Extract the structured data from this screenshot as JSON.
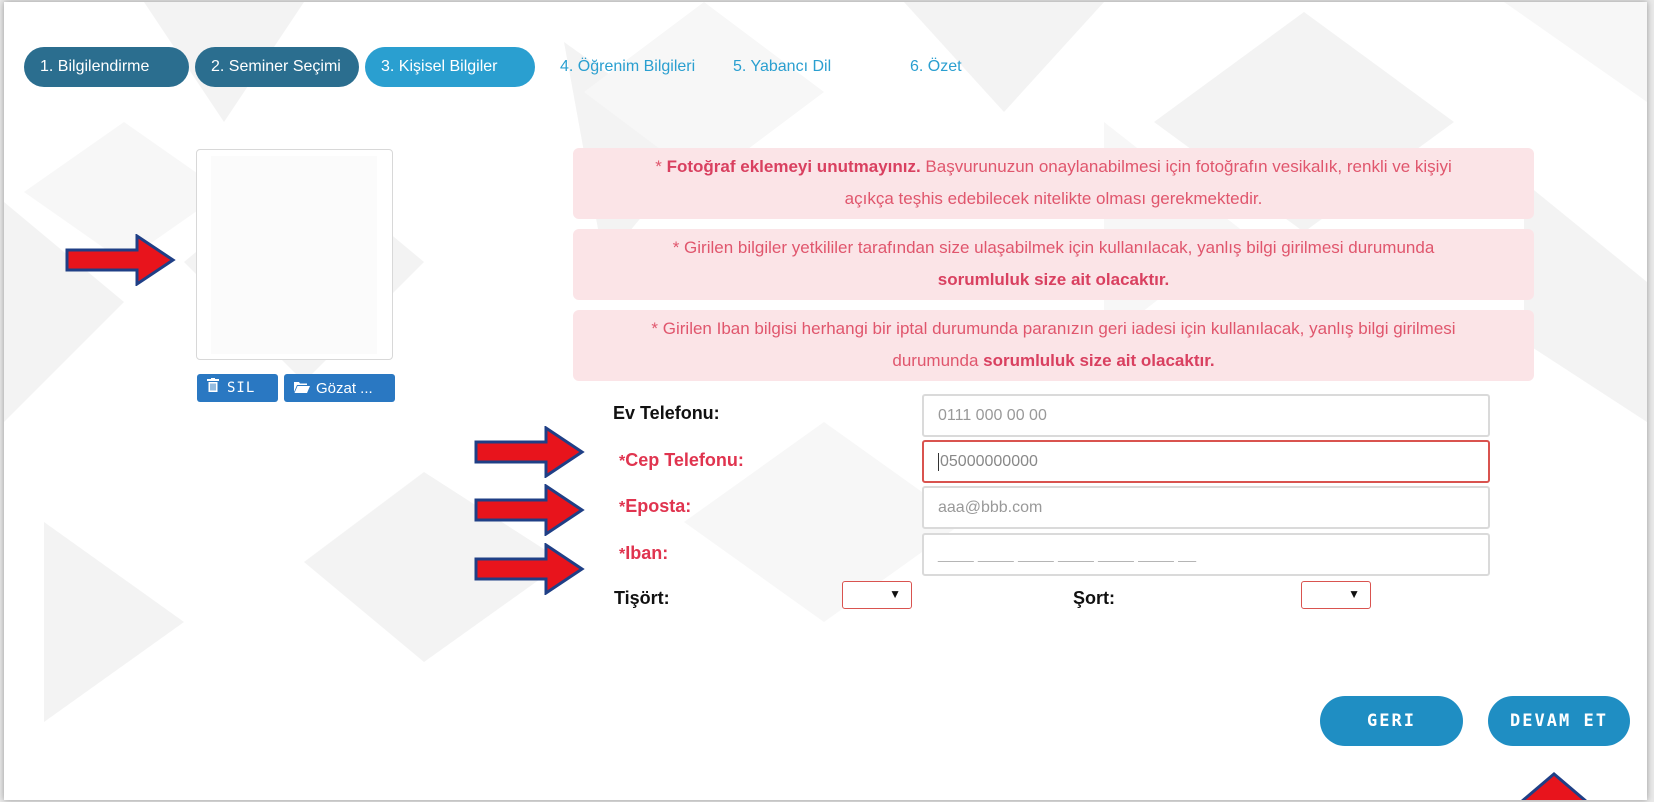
{
  "steps": [
    {
      "label": "1. Bilgilendirme",
      "state": "done"
    },
    {
      "label": "2. Seminer Seçimi",
      "state": "done"
    },
    {
      "label": "3. Kişisel Bilgiler",
      "state": "active"
    },
    {
      "label": "4. Öğrenim Bilgileri",
      "state": "pending"
    },
    {
      "label": "5. Yabancı Dil",
      "state": "pending"
    },
    {
      "label": "6. Özet",
      "state": "pending"
    }
  ],
  "photo": {
    "delete_label": "SIL",
    "browse_label": "Gözat ..."
  },
  "alerts": [
    {
      "pre": "* ",
      "bold": "Fotoğraf eklemeyi unutmayınız.",
      "rest": " Başvurunuzun onaylanabilmesi için fotoğrafın vesikalık, renkli ve kişiyi",
      "line2": "açıkça teşhis edebilecek nitelikte olması gerekmektedir."
    },
    {
      "line1": "* Girilen bilgiler yetkililer tarafından size ulaşabilmek için kullanılacak, yanlış bilgi girilmesi durumunda",
      "bold2": "sorumluluk size ait olacaktır."
    },
    {
      "line1": "* Girilen Iban bilgisi herhangi bir iptal durumunda paranızın geri iadesi için kullanılacak, yanlış bilgi girilmesi",
      "pre2": "durumunda ",
      "bold2": "sorumluluk size ait olacaktır."
    }
  ],
  "form": {
    "home_phone": {
      "label": "Ev Telefonu:",
      "placeholder": "0111 000 00 00"
    },
    "mobile_phone": {
      "star": "*",
      "label": "Cep Telefonu:",
      "placeholder": "05000000000"
    },
    "email": {
      "star": "*",
      "label": "Eposta:",
      "placeholder": "aaa@bbb.com"
    },
    "iban": {
      "star": "*",
      "label": "Iban:",
      "placeholder": "____ ____ ____ ____ ____ ____ __"
    },
    "tshirt": {
      "label": "Tişört:",
      "value": ""
    },
    "shorts": {
      "label": "Şort:",
      "value": ""
    }
  },
  "buttons": {
    "back": "GERI",
    "next": "DEVAM ET"
  },
  "colors": {
    "step_done": "#2b6e8f",
    "step_active": "#2a9fd0",
    "alert_bg": "#fbe4e7",
    "alert_text": "#e0566d",
    "required": "#e0344f",
    "nav_button": "#1f8ec3",
    "annotation_arrow": "#e8141c",
    "annotation_arrow_outline": "#1f3f86"
  }
}
